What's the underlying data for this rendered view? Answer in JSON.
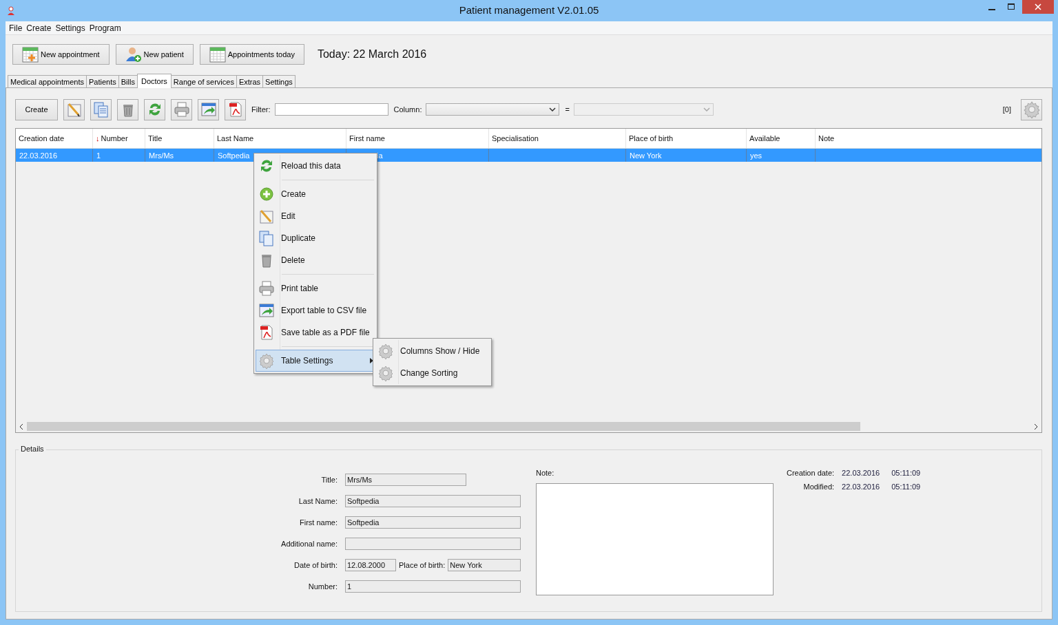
{
  "window": {
    "title": "Patient management V2.01.05"
  },
  "menu_bar": [
    "File",
    "Create",
    "Settings",
    "Program"
  ],
  "quick_buttons": [
    {
      "label": "New appointment"
    },
    {
      "label": "New patient"
    },
    {
      "label": "Appointments today"
    }
  ],
  "today": "Today: 22 March 2016",
  "tabs": [
    {
      "label": "Medical appointments",
      "selected": false
    },
    {
      "label": "Patients",
      "selected": false
    },
    {
      "label": "Bills",
      "selected": false
    },
    {
      "label": "Doctors",
      "selected": true
    },
    {
      "label": "Range of services",
      "selected": false
    },
    {
      "label": "Extras",
      "selected": false
    },
    {
      "label": "Settings",
      "selected": false
    }
  ],
  "toolbar": {
    "create_button": "Create",
    "filter_label": "Filter:",
    "column_label": "Column:",
    "equals": "=",
    "count": "[0]"
  },
  "table": {
    "columns": [
      {
        "label": "Creation date"
      },
      {
        "label": "Number",
        "sort_arrow": "↓"
      },
      {
        "label": "Title"
      },
      {
        "label": "Last Name"
      },
      {
        "label": "First name"
      },
      {
        "label": "Specialisation"
      },
      {
        "label": "Place of birth"
      },
      {
        "label": "Available"
      },
      {
        "label": "Note"
      }
    ],
    "rows": [
      {
        "selected": true,
        "cells": [
          "22.03.2016",
          "1",
          "Mrs/Ms",
          "Softpedia",
          "ia",
          "",
          "New York",
          "yes",
          ""
        ]
      }
    ]
  },
  "context_menu": {
    "sections": [
      [
        {
          "label": "Reload this data",
          "highlighted": false,
          "submenu": false
        }
      ],
      [
        {
          "label": "Create",
          "highlighted": false,
          "submenu": false
        },
        {
          "label": "Edit",
          "highlighted": false,
          "submenu": false
        },
        {
          "label": "Duplicate",
          "highlighted": false,
          "submenu": false
        },
        {
          "label": "Delete",
          "highlighted": false,
          "submenu": false
        }
      ],
      [
        {
          "label": "Print table",
          "highlighted": false,
          "submenu": false
        },
        {
          "label": "Export table to CSV file",
          "highlighted": false,
          "submenu": false
        },
        {
          "label": "Save table as a PDF file",
          "highlighted": false,
          "submenu": false
        }
      ],
      [
        {
          "label": "Table Settings",
          "highlighted": true,
          "submenu": true
        }
      ]
    ],
    "submenu": [
      "Columns Show / Hide",
      "Change Sorting"
    ]
  },
  "details": {
    "legend": "Details",
    "fields": [
      {
        "label": "Title:",
        "value": "Mrs/Ms"
      },
      {
        "label": "Last Name:",
        "value": "Softpedia"
      },
      {
        "label": "First name:",
        "value": "Softpedia"
      },
      {
        "label": "Additional name:"
      },
      {
        "label": "Date of birth:",
        "value": "12.08.2000"
      },
      {
        "label": "Place of birth:",
        "value": "New York"
      },
      {
        "label": "Number:",
        "value": "1"
      }
    ],
    "note_label": "Note:",
    "dates": [
      {
        "label": "Creation date:",
        "date": "22.03.2016",
        "time": "05:11:09"
      },
      {
        "label": "Modified:",
        "date": "22.03.2016",
        "time": "05:11:09"
      }
    ]
  }
}
